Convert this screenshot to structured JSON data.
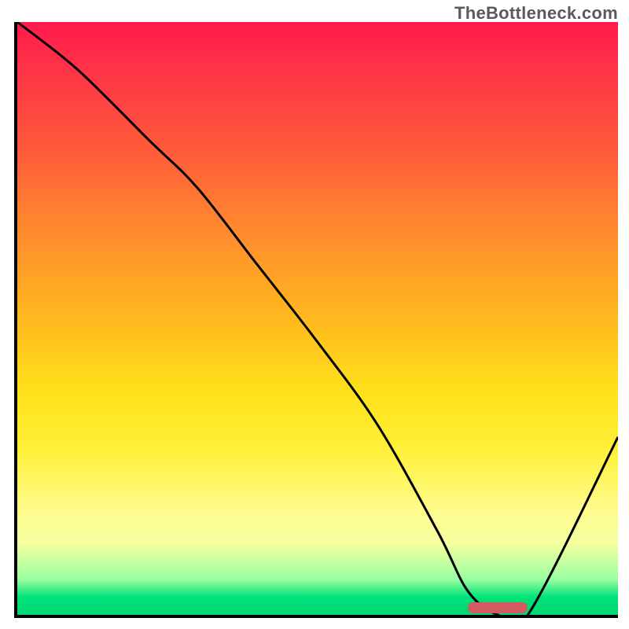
{
  "watermark": "TheBottleneck.com",
  "colors": {
    "gradient_top": "#ff1a4d",
    "gradient_mid1": "#ff8a2e",
    "gradient_mid2": "#ffe01a",
    "gradient_mid3": "#fffb8a",
    "gradient_bottom": "#00d770",
    "curve": "#000000",
    "axis": "#000000",
    "marker": "#d45a5f"
  },
  "chart_data": {
    "type": "line",
    "title": "",
    "xlabel": "",
    "ylabel": "",
    "xlim": [
      0,
      100
    ],
    "ylim": [
      0,
      100
    ],
    "series": [
      {
        "name": "bottleneck-curve",
        "x": [
          0,
          10,
          22,
          30,
          40,
          50,
          60,
          70,
          75,
          80,
          85,
          100
        ],
        "y": [
          100,
          92,
          80,
          72,
          59,
          46,
          32,
          14,
          4,
          0,
          0,
          30
        ]
      }
    ],
    "marker": {
      "x_start": 75,
      "x_end": 85,
      "y": 0
    },
    "gradient_stops": [
      {
        "pos": 0,
        "color": "#ff1a4d"
      },
      {
        "pos": 20,
        "color": "#ff553b"
      },
      {
        "pos": 50,
        "color": "#ffb81f"
      },
      {
        "pos": 72,
        "color": "#fff038"
      },
      {
        "pos": 88,
        "color": "#f4ffa0"
      },
      {
        "pos": 97,
        "color": "#00e27a"
      },
      {
        "pos": 100,
        "color": "#00d770"
      }
    ]
  }
}
